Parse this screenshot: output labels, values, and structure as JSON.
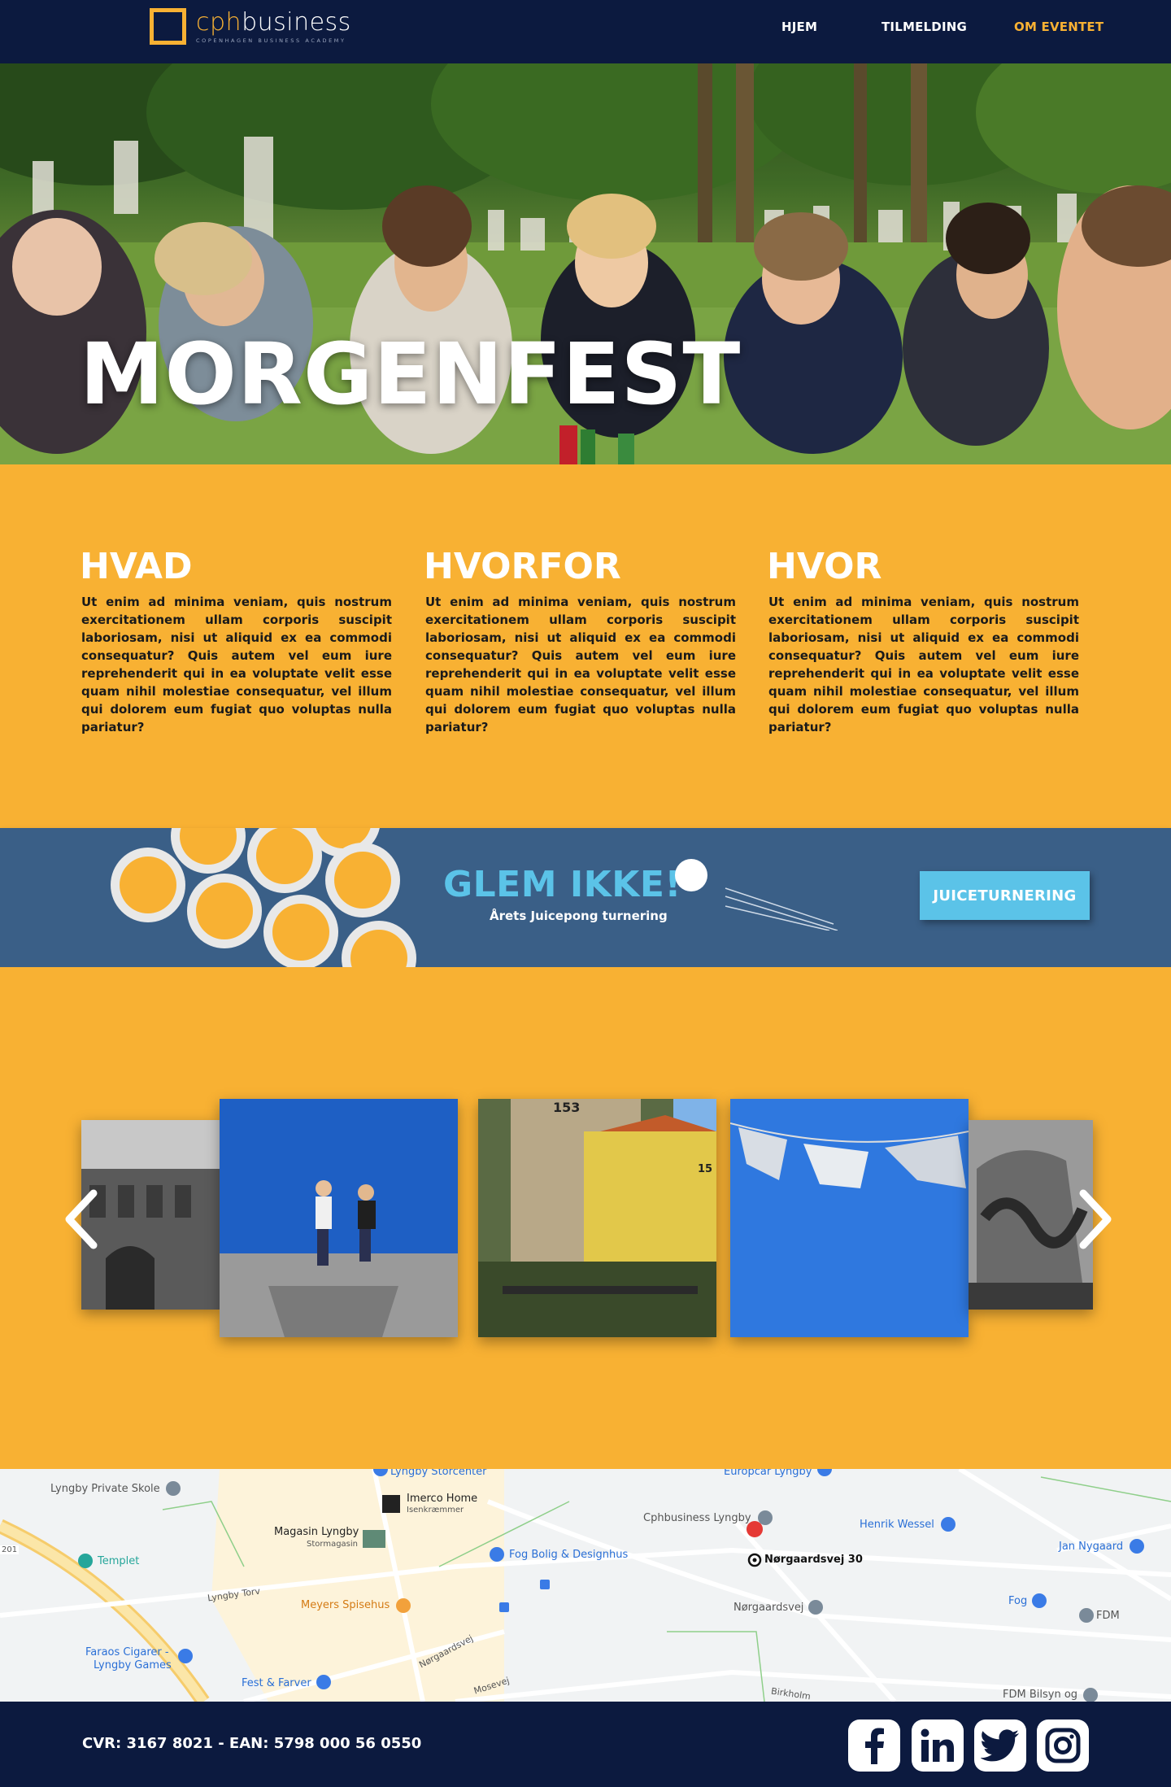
{
  "nav": {
    "logo_cph": "cph",
    "logo_business": "business",
    "logo_tagline": "COPENHAGEN BUSINESS ACADEMY",
    "links": [
      {
        "label": "HJEM",
        "active": false
      },
      {
        "label": "TILMELDING",
        "active": false
      },
      {
        "label": "OM EVENTET",
        "active": true
      }
    ]
  },
  "hero": {
    "title": "MORGENFEST"
  },
  "info": {
    "columns": [
      {
        "title": "HVAD",
        "text": "Ut enim ad minima veniam, quis nostrum exercitationem ullam corporis suscipit laboriosam, nisi ut aliquid ex ea commodi consequatur? Quis autem vel eum iure reprehenderit qui in ea voluptate velit esse quam nihil molestiae consequatur, vel illum qui dolorem eum fugiat quo voluptas nulla pariatur?"
      },
      {
        "title": "HVORFOR",
        "text": "Ut enim ad minima veniam, quis nostrum exercitationem ullam corporis suscipit laboriosam, nisi ut aliquid ex ea commodi consequatur? Quis autem vel eum iure reprehenderit qui in ea voluptate velit esse quam nihil molestiae consequatur, vel illum qui dolorem eum fugiat quo voluptas nulla pariatur?"
      },
      {
        "title": "HVOR",
        "text": "Ut enim ad minima veniam, quis nostrum exercitationem ullam corporis suscipit laboriosam, nisi ut aliquid ex ea commodi consequatur? Quis autem vel eum iure reprehenderit qui in ea voluptate velit esse quam nihil molestiae consequatur, vel illum qui dolorem eum fugiat quo voluptas nulla pariatur?"
      }
    ]
  },
  "banner": {
    "title": "GLEM IKKE!",
    "subtitle": "Årets Juicepong turnering",
    "button": "JUICETURNERING"
  },
  "gallery": {
    "photo_153": "153",
    "photo_15": "15"
  },
  "map": {
    "labels": {
      "lyngby_storcenter": "Lyngby Storcenter",
      "europcar": "Europcar Lyngby",
      "private_skole": "Lyngby Private Skole",
      "imerco": "Imerco Home",
      "imerco_sub": "Isenkræmmer",
      "cphbusiness": "Cphbusiness Lyngby",
      "henrik": "Henrik Wessel",
      "magasin": "Magasin Lyngby",
      "magasin_sub": "Stormagasin",
      "fog_bolig": "Fog Bolig & Designhus",
      "norgaardsvej30": "Nørgaardsvej 30",
      "jan": "Jan Nygaard",
      "templet": "Templet",
      "lyngby_torv": "Lyngby Torv",
      "meyers": "Meyers Spisehus",
      "norgaardsvej": "Nørgaardsvej",
      "fog": "Fog",
      "fdm": "FDM",
      "faraos": "Faraos Cigarer -",
      "lyngby_games": "Lyngby Games",
      "norgaardsvej_road": "Nørgaardsvej",
      "fest_farver": "Fest & Farver",
      "mosevej": "Mosevej",
      "birkholm": "Birkholm",
      "fdm_bilsyn": "FDM Bilsyn og",
      "road_201": "201"
    }
  },
  "footer": {
    "text": "CVR: 3167 8021 - EAN: 5798 000 56 0550",
    "social": [
      "facebook-icon",
      "linkedin-icon",
      "twitter-icon",
      "instagram-icon"
    ]
  },
  "colors": {
    "navy": "#0c1a3f",
    "orange": "#f8b133",
    "banner_blue": "#3a5f87",
    "light_blue": "#5bc3e8"
  }
}
